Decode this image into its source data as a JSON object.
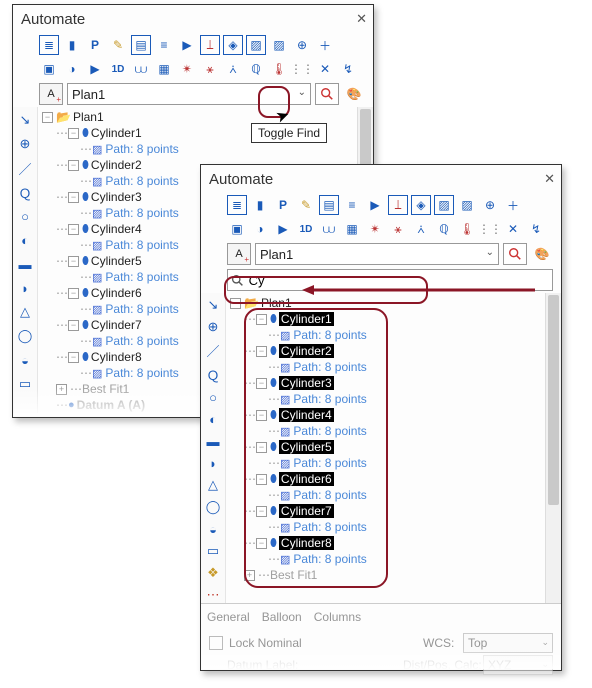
{
  "tooltip": "Toggle Find",
  "panel1": {
    "title": "Automate",
    "plan_combo": "Plan1",
    "plan_btn_label": "A",
    "tree_root": "Plan1",
    "items": [
      {
        "name": "Cylinder1",
        "path": "Path: 8 points"
      },
      {
        "name": "Cylinder2",
        "path": "Path: 8 points"
      },
      {
        "name": "Cylinder3",
        "path": "Path: 8 points"
      },
      {
        "name": "Cylinder4",
        "path": "Path: 8 points"
      },
      {
        "name": "Cylinder5",
        "path": "Path: 8 points"
      },
      {
        "name": "Cylinder6",
        "path": "Path: 8 points"
      },
      {
        "name": "Cylinder7",
        "path": "Path: 8 points"
      },
      {
        "name": "Cylinder8",
        "path": "Path: 8 points"
      }
    ],
    "extra1": "Best Fit1",
    "extra2": "Datum A (A)"
  },
  "panel2": {
    "title": "Automate",
    "plan_combo": "Plan1",
    "plan_btn_label": "A",
    "search_value": "Cy",
    "tree_root": "Plan1",
    "items": [
      {
        "name": "Cylinder1",
        "path": "Path: 8 points"
      },
      {
        "name": "Cylinder2",
        "path": "Path: 8 points"
      },
      {
        "name": "Cylinder3",
        "path": "Path: 8 points"
      },
      {
        "name": "Cylinder4",
        "path": "Path: 8 points"
      },
      {
        "name": "Cylinder5",
        "path": "Path: 8 points"
      },
      {
        "name": "Cylinder6",
        "path": "Path: 8 points"
      },
      {
        "name": "Cylinder7",
        "path": "Path: 8 points"
      },
      {
        "name": "Cylinder8",
        "path": "Path: 8 points"
      }
    ],
    "extra1": "Best Fit1",
    "tabs": [
      "General",
      "Balloon",
      "Columns"
    ],
    "prop_lock": "Lock Nominal",
    "prop_wcs_label": "WCS:",
    "prop_wcs_value": "Top",
    "prop_datum": "Datum Label:",
    "prop_calc_label": "Dist/Pos. Calc:",
    "prop_calc_value": "XYZ"
  }
}
